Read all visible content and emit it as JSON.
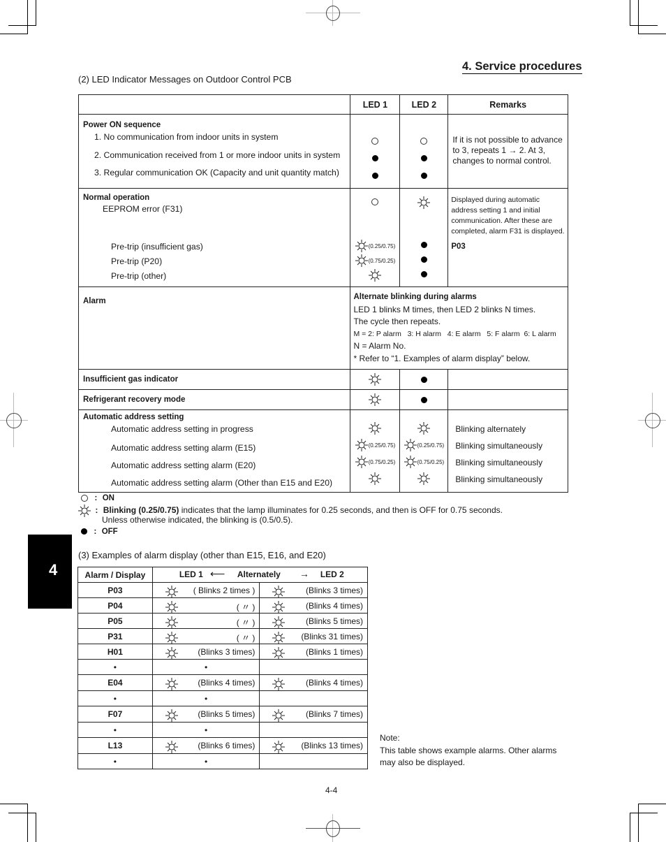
{
  "page": {
    "section_header": "4. Service procedures",
    "chapter_tab": "4",
    "page_number": "4-4"
  },
  "led_section": {
    "title": "(2) LED Indicator Messages on Outdoor Control PCB",
    "headers": [
      "",
      "LED 1",
      "LED 2",
      "Remarks"
    ],
    "power_on": {
      "heading": "Power ON sequence",
      "items": [
        {
          "label": "1. No communication from indoor units in system",
          "led1": "on",
          "led2": "on"
        },
        {
          "label": "2. Communication received from 1 or more indoor units in system",
          "led1": "off",
          "led2": "off"
        },
        {
          "label": "3. Regular communication OK (Capacity and unit quantity match)",
          "led1": "off",
          "led2": "off"
        }
      ],
      "remarks": "If it is not possible to advance to 3, repeats 1 → 2. At 3, changes to normal control."
    },
    "normal": {
      "heading": "Normal operation",
      "eeprom": {
        "label": "EEPROM error (F31)",
        "led1": "on",
        "led2": "blink",
        "remarks": "Displayed during automatic address setting 1 and initial communication. After these are completed, alarm F31 is displayed."
      },
      "pretrips": [
        {
          "label": "Pre-trip (insufficient gas)",
          "led1": "blink",
          "led1_timing": "(0.25/0.75)",
          "led2": "off",
          "remarks": "P03"
        },
        {
          "label": "Pre-trip (P20)",
          "led1": "blink",
          "led1_timing": "(0.75/0.25)",
          "led2": "off",
          "remarks": ""
        },
        {
          "label": "Pre-trip (other)",
          "led1": "blink",
          "led1_timing": "",
          "led2": "off",
          "remarks": ""
        }
      ]
    },
    "alarm": {
      "heading": "Alarm",
      "remarks_title": "Alternate blinking during alarms",
      "remarks_line1": "LED 1 blinks M times, then LED 2 blinks N times.",
      "remarks_line2": "The cycle then repeats.",
      "remarks_line3": "M = 2: P alarm   3: H alarm   4: E alarm   5: F alarm  6: L alarm",
      "remarks_line4": "N = Alarm No.",
      "remarks_line5": "* Refer to “1. Examples of alarm display” below."
    },
    "insufficient_gas": {
      "heading": "Insufficient gas indicator",
      "led1": "blink",
      "led2": "off"
    },
    "refrigerant_recovery": {
      "heading": "Refrigerant recovery mode",
      "led1": "blink",
      "led2": "off"
    },
    "auto_address": {
      "heading": "Automatic address setting",
      "items": [
        {
          "label": "Automatic address setting in progress",
          "led1_timing": "",
          "led2_timing": "",
          "remarks": "Blinking alternately"
        },
        {
          "label": "Automatic address setting alarm (E15)",
          "led1_timing": "(0.25/0.75)",
          "led2_timing": "(0.25/0.75)",
          "remarks": "Blinking simultaneously"
        },
        {
          "label": "Automatic address setting alarm (E20)",
          "led1_timing": "(0.75/0.25)",
          "led2_timing": "(0.75/0.25)",
          "remarks": "Blinking simultaneously"
        },
        {
          "label": "Automatic address setting alarm (Other than E15 and E20)",
          "led1_timing": "",
          "led2_timing": "",
          "remarks": "Blinking simultaneously"
        }
      ]
    }
  },
  "legend": {
    "on_label": "ON",
    "blink_bold": "Blinking (0.25/0.75)",
    "blink_text": " indicates that the lamp illuminates for 0.25 seconds, and then is OFF for 0.75 seconds.",
    "blink_text2": "Unless otherwise indicated, the blinking is (0.5/0.5).",
    "off_label": "OFF",
    "colon": ":"
  },
  "alarm_examples": {
    "title": "(3) Examples of alarm display (other than E15, E16, and E20)",
    "header_col1": "Alarm / Display",
    "header_led1": "LED 1",
    "header_left_arrow": "⟵",
    "header_mid": "Alternately",
    "header_right_arrow": "→",
    "header_led2": "LED 2",
    "rows": [
      {
        "code": "P03",
        "led1": "( Blinks 2 times )",
        "led2": "(Blinks 3 times)"
      },
      {
        "code": "P04",
        "led1": "( 〃 )",
        "led2": "(Blinks 4 times)"
      },
      {
        "code": "P05",
        "led1": "( 〃 )",
        "led2": "(Blinks 5 times)"
      },
      {
        "code": "P31",
        "led1": "( 〃 )",
        "led2": "(Blinks 31 times)"
      },
      {
        "code": "H01",
        "led1": "(Blinks 3 times)",
        "led2": "(Blinks 1 times)"
      },
      {
        "code": "•",
        "led1": "•",
        "led2": "",
        "ellipsis": true
      },
      {
        "code": "E04",
        "led1": "(Blinks 4 times)",
        "led2": "(Blinks 4 times)"
      },
      {
        "code": "•",
        "led1": "•",
        "led2": "",
        "ellipsis": true
      },
      {
        "code": "F07",
        "led1": "(Blinks 5 times)",
        "led2": "(Blinks 7 times)"
      },
      {
        "code": "•",
        "led1": "•",
        "led2": "",
        "ellipsis": true
      },
      {
        "code": "L13",
        "led1": "(Blinks 6 times)",
        "led2": "(Blinks 13 times)"
      },
      {
        "code": "•",
        "led1": "•",
        "led2": "",
        "ellipsis": true
      }
    ],
    "note_title": "Note:",
    "note_text": "This table shows example alarms. Other alarms may also be displayed."
  }
}
